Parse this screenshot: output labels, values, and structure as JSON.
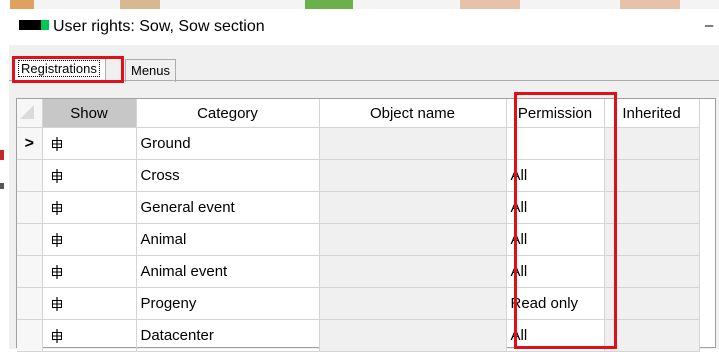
{
  "window": {
    "title": "User rights: Sow, Sow section",
    "minimize_glyph": "–"
  },
  "tabs": [
    {
      "label": "Registrations",
      "active": true
    },
    {
      "label": "Menus",
      "active": false
    }
  ],
  "grid": {
    "columns": [
      "Show",
      "Category",
      "Object name",
      "Permission",
      "Inherited"
    ],
    "current_row_marker": ">",
    "rows": [
      {
        "category": "Ground",
        "object_name": "",
        "permission": "",
        "inherited": ""
      },
      {
        "category": "Cross",
        "object_name": "",
        "permission": "All",
        "inherited": ""
      },
      {
        "category": "General event",
        "object_name": "",
        "permission": "All",
        "inherited": ""
      },
      {
        "category": "Animal",
        "object_name": "",
        "permission": "All",
        "inherited": ""
      },
      {
        "category": "Animal event",
        "object_name": "",
        "permission": "All",
        "inherited": ""
      },
      {
        "category": "Progeny",
        "object_name": "",
        "permission": "Read only",
        "inherited": ""
      },
      {
        "category": "Datacenter",
        "object_name": "",
        "permission": "All",
        "inherited": ""
      }
    ]
  },
  "icons": {
    "expand": "expand-tree-icon",
    "app": "app-icon"
  },
  "colors": {
    "highlight": "#e0101a",
    "show_header": "#c7c7c7",
    "app_icon_green": "#00c853"
  }
}
